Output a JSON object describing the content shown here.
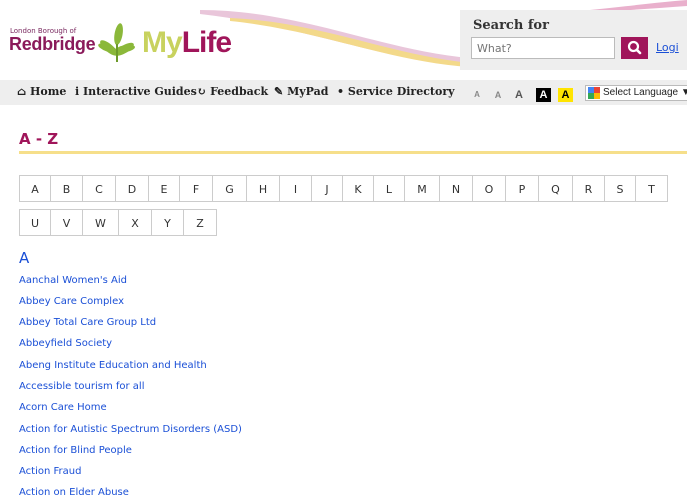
{
  "header": {
    "borough_line": "London Borough of",
    "borough_name": "Redbridge",
    "brand_my": "My",
    "brand_life": "Life"
  },
  "search": {
    "title": "Search for",
    "placeholder": "What?",
    "login": "Logi"
  },
  "nav": {
    "items": [
      {
        "icon": "home-icon",
        "glyph": "⌂",
        "label": "Home"
      },
      {
        "icon": "info-icon",
        "glyph": "i",
        "label": "Interactive Guides"
      },
      {
        "icon": "refresh-icon",
        "glyph": "↻",
        "label": "Feedback"
      },
      {
        "icon": "edit-icon",
        "glyph": "✎",
        "label": "MyPad"
      },
      {
        "icon": "map-marker-icon",
        "glyph": "•",
        "label": "Service Directory"
      }
    ],
    "text_sizes": [
      "A",
      "A",
      "A",
      "A",
      "A"
    ],
    "language": "Select Language",
    "language_arrow": "▼"
  },
  "page": {
    "title": "A - Z",
    "letters_row1": [
      "A",
      "B",
      "C",
      "D",
      "E",
      "F",
      "G",
      "H",
      "I",
      "J",
      "K",
      "L",
      "M",
      "N",
      "O",
      "P",
      "Q",
      "R",
      "S",
      "T"
    ],
    "letters_row2": [
      "U",
      "V",
      "W",
      "X",
      "Y",
      "Z"
    ],
    "section": "A",
    "organisations": [
      "Aanchal Women's Aid",
      "Abbey Care Complex",
      "Abbey Total Care Group Ltd",
      "Abbeyfield Society",
      "Abeng Institute Education and Health",
      "Accessible tourism for all",
      "Acorn Care Home",
      "Action for Autistic Spectrum Disorders (ASD)",
      "Action for Blind People",
      "Action Fraud",
      "Action on Elder Abuse"
    ]
  },
  "colors": {
    "brand_purple": "#a0155a",
    "brand_green": "#c8d25e",
    "link_blue": "#1a4fd6",
    "rule_yellow": "#f6df8a"
  }
}
